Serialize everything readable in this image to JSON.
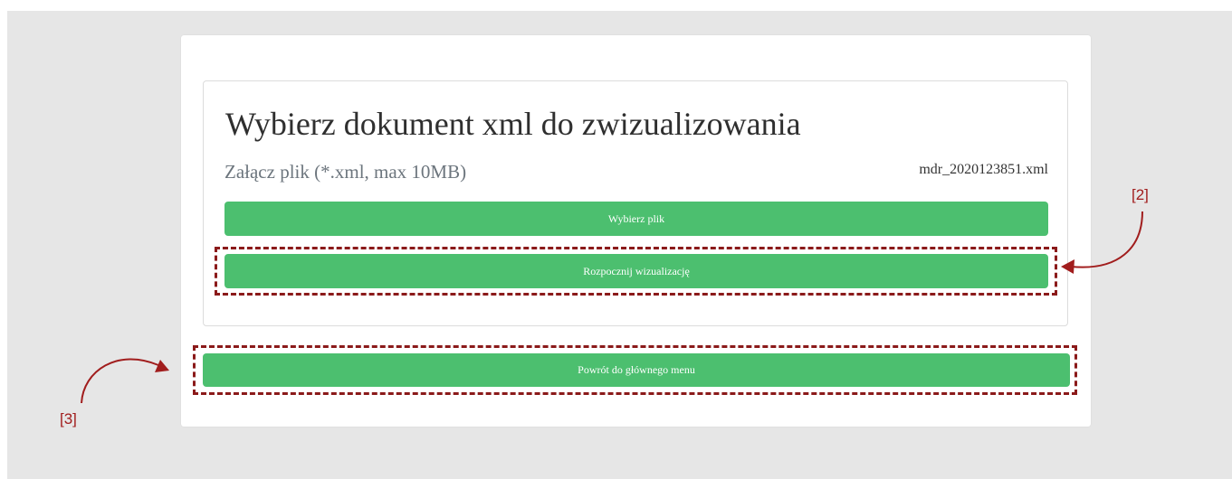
{
  "page": {
    "title": "Wybierz dokument xml do zwizualizowania",
    "subtitle": "Załącz plik (*.xml, max 10MB)",
    "selected_file": "mdr_2020123851.xml"
  },
  "buttons": {
    "choose_file": "Wybierz plik",
    "start_visualization": "Rozpocznij wizualizację",
    "back_to_menu": "Powrót do głównego menu"
  },
  "annotations": {
    "marker_2": "[2]",
    "marker_3": "[3]"
  },
  "colors": {
    "button": "#4cbf6f",
    "annotation": "#8b1a1a",
    "background": "#e6e6e6"
  }
}
